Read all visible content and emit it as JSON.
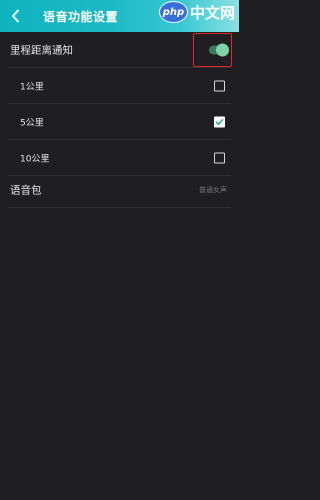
{
  "header": {
    "title": "语音功能设置",
    "watermark_badge": "php",
    "watermark_text": "中文网"
  },
  "mileage_notice": {
    "label": "里程距离通知",
    "enabled": true
  },
  "distance_options": [
    {
      "label": "1公里",
      "checked": false
    },
    {
      "label": "5公里",
      "checked": true
    },
    {
      "label": "10公里",
      "checked": false
    }
  ],
  "voice_pack": {
    "label": "语音包",
    "value": "普通女声"
  },
  "colors": {
    "header_gradient_start": "#0fb3c0",
    "header_gradient_end": "#8ddfe3",
    "background": "#1f1f22",
    "toggle_on": "#7ed4a8",
    "highlight": "#e02828"
  }
}
